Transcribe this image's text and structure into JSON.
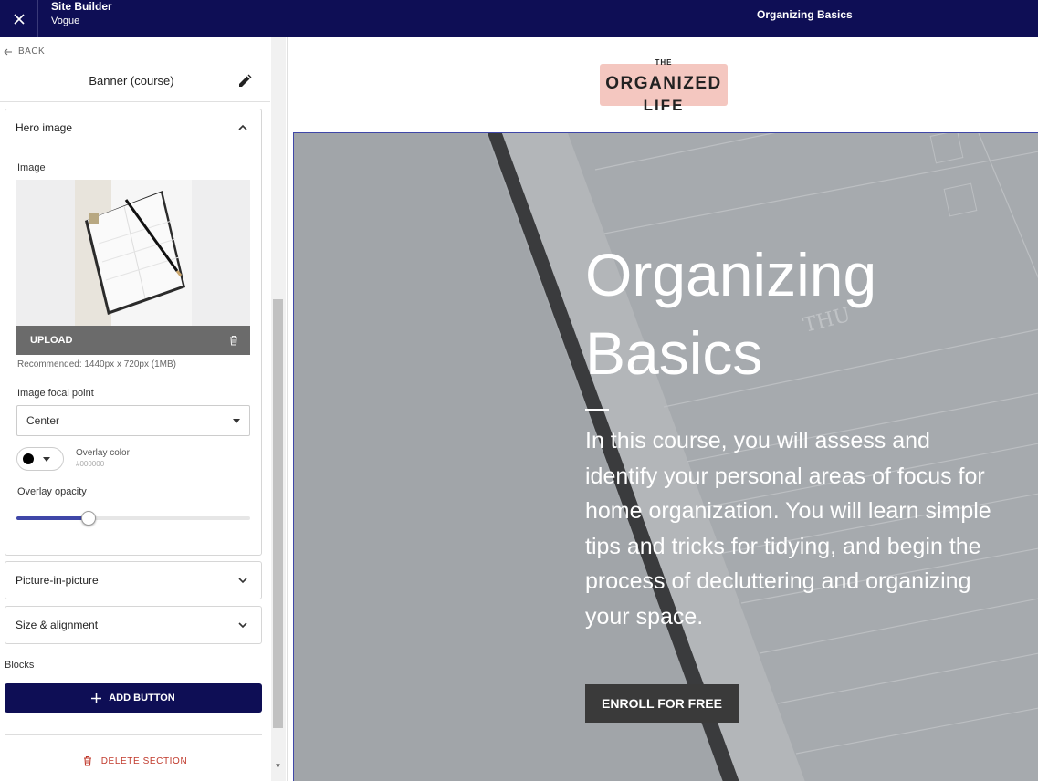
{
  "topbar": {
    "app_title": "Site Builder",
    "app_subtitle": "Vogue",
    "page_title": "Organizing Basics"
  },
  "sidebar": {
    "back_label": "BACK",
    "section_title": "Banner (course)",
    "panels": {
      "hero_image": {
        "title": "Hero image",
        "image_label": "Image",
        "upload_label": "UPLOAD",
        "recommended": "Recommended: 1440px x 720px (1MB)",
        "focal_label": "Image focal point",
        "focal_value": "Center",
        "overlay_color_label": "Overlay color",
        "overlay_color_value": "#000000",
        "overlay_opacity_label": "Overlay opacity",
        "overlay_opacity_fraction": 0.31
      },
      "pip": {
        "title": "Picture-in-picture"
      },
      "size": {
        "title": "Size & alignment"
      }
    },
    "blocks_label": "Blocks",
    "add_button_label": "ADD BUTTON",
    "delete_label": "DELETE SECTION"
  },
  "preview": {
    "logo": {
      "line1": "THE",
      "line2": "ORGANIZED",
      "line3": "LIFE"
    },
    "hero": {
      "title": "Organizing Basics",
      "description": "In this course, you will assess and identify your personal areas of focus for home organization. You will learn simple tips and tricks for tidying, and begin the process of decluttering and organizing your space.",
      "button_label": "ENROLL FOR FREE",
      "planner_text": "THU"
    }
  },
  "colors": {
    "brand_navy": "#0e0e55",
    "accent_blue": "#3f47a8",
    "logo_pink": "#f4c7c0",
    "delete_red": "#c0392b"
  }
}
